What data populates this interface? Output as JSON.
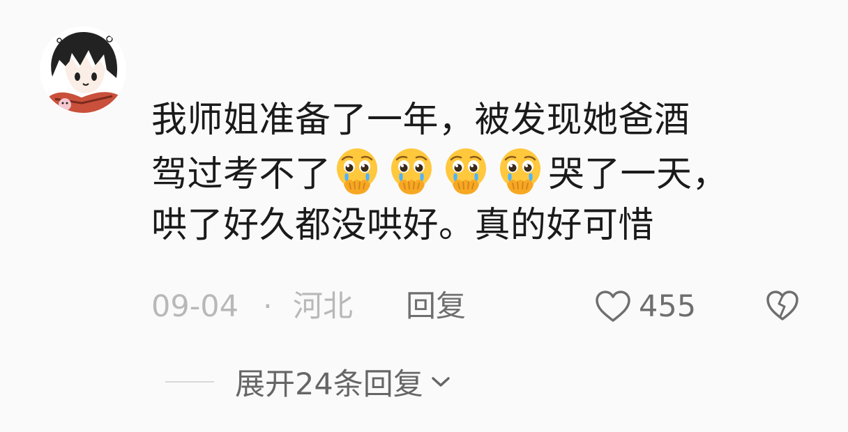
{
  "comment": {
    "text_line1": "我师姐准备了一年，被发现她爸酒",
    "text_line2_pre": "驾过考不了",
    "emoji_name": "pleading-crying-face",
    "text_line2_post": "哭了一天，",
    "text_line3": "哄了好久都没哄好。真的好可惜",
    "date": "09-04",
    "separator": "·",
    "location": "河北",
    "reply_label": "回复",
    "like_count": "455",
    "expand_label": "展开24条回复"
  },
  "icons": {
    "like": "heart-outline-icon",
    "dislike": "broken-heart-icon",
    "expand": "chevron-down-icon"
  },
  "colors": {
    "background": "#fafafa",
    "text": "#1a1a1a",
    "meta": "#b8b8b8",
    "action": "#6e6e6e",
    "emoji_face": "#ffc83d"
  }
}
